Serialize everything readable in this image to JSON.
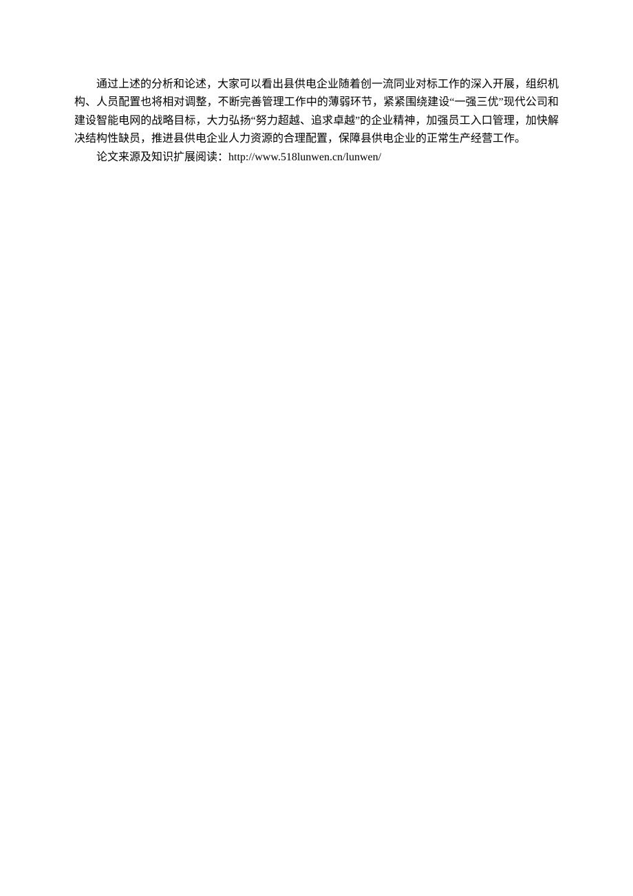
{
  "paragraphs": {
    "p1": "通过上述的分析和论述，大家可以看出县供电企业随着创一流同业对标工作的深入开展，组织机构、人员配置也将相对调整，不断完善管理工作中的薄弱环节，紧紧围绕建设“一强三优”现代公司和建设智能电网的战略目标，大力弘扬“努力超越、追求卓越”的企业精神，加强员工入口管理，加快解决结构性缺员，推进县供电企业人力资源的合理配置，保障县供电企业的正常生产经营工作。",
    "p2": "论文来源及知识扩展阅读：http://www.518lunwen.cn/lunwen/"
  }
}
